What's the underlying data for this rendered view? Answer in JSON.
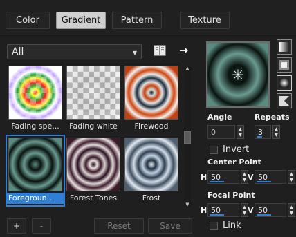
{
  "tabs": [
    {
      "label": "Color"
    },
    {
      "label": "Gradient"
    },
    {
      "label": "Pattern"
    },
    {
      "label": "Texture"
    }
  ],
  "dropdown": {
    "value": "All"
  },
  "gradients": [
    {
      "label": "Fading spe..."
    },
    {
      "label": "Fading white"
    },
    {
      "label": "Firewood"
    },
    {
      "label": "Foregroun..."
    },
    {
      "label": "Forest Tones"
    },
    {
      "label": "Frost"
    }
  ],
  "bottom_buttons": {
    "add": "+",
    "remove": "-",
    "reset": "Reset",
    "save": "Save"
  },
  "settings": {
    "angle_label": "Angle",
    "angle_value": "0",
    "repeats_label": "Repeats",
    "repeats_value": "3",
    "invert_label": "Invert",
    "center_point_label": "Center Point",
    "center_h_label": "H",
    "center_h_value": "50",
    "center_v_label": "V",
    "center_v_value": "50",
    "focal_point_label": "Focal Point",
    "focal_h_label": "H",
    "focal_h_value": "50",
    "focal_v_label": "V",
    "focal_v_value": "50",
    "link_label": "Link"
  },
  "colors": {
    "accent": "#2f7fd6"
  }
}
